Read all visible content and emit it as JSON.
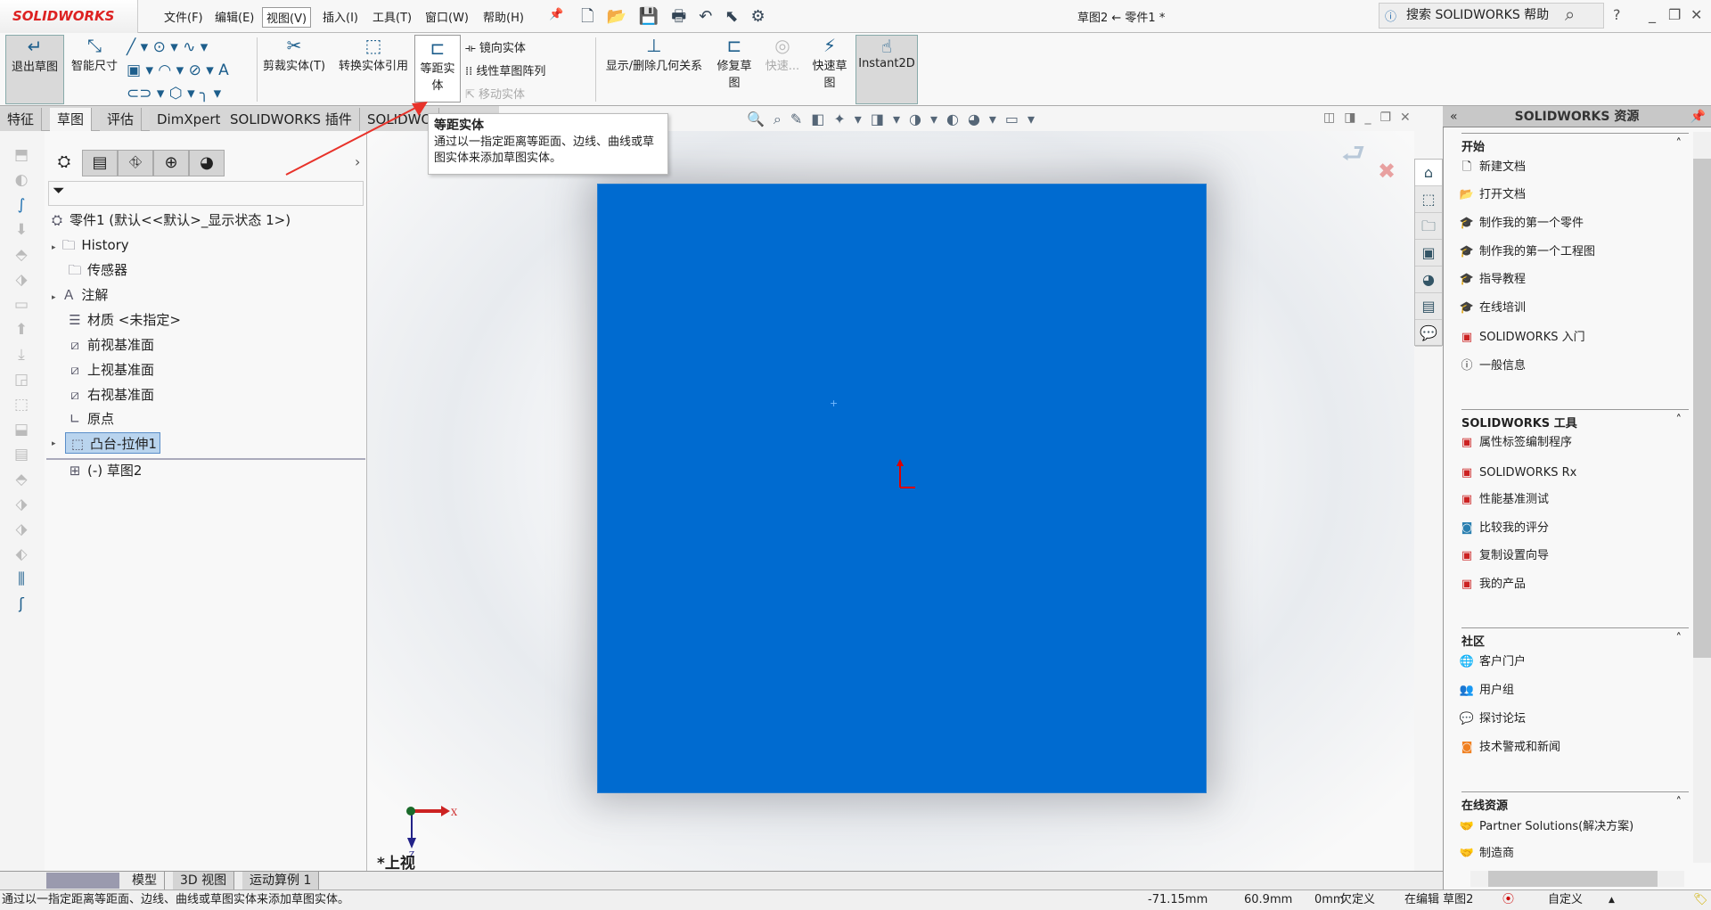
{
  "app": {
    "logo": "SOLIDWORKS",
    "title": "草图2 ← 零件1 *"
  },
  "menu": [
    "文件(F)",
    "编辑(E)",
    "视图(V)",
    "插入(I)",
    "工具(T)",
    "窗口(W)",
    "帮助(H)"
  ],
  "search": {
    "placeholder": "搜索 SOLIDWORKS 帮助"
  },
  "ribbon": {
    "exit_sketch": "退出草图",
    "smart_dim": "智能尺寸",
    "trim": "剪裁实体(T)",
    "convert": "转换实体引用",
    "offset": "等距实体",
    "mirror": "镜向实体",
    "linear_pattern": "线性草图阵列",
    "move": "移动实体",
    "relations": "显示/删除几何关系",
    "repair": "修复草图",
    "quick_snap": "快速...",
    "rapid_sketch": "快速草图",
    "instant2d": "Instant2D"
  },
  "tabs": [
    "特征",
    "草图",
    "评估",
    "DimXpert",
    "SOLIDWORKS 插件",
    "SOLIDWO"
  ],
  "tooltip": {
    "title": "等距实体",
    "body": "通过以一指定距离等距面、边线、曲线或草图实体来添加草图实体。"
  },
  "tree": {
    "root": "零件1  (默认<<默认>_显示状态 1>)",
    "items": [
      "History",
      "传感器",
      "注解",
      "材质 <未指定>",
      "前视基准面",
      "上视基准面",
      "右视基准面",
      "原点",
      "凸台-拉伸1",
      "(-) 草图2"
    ]
  },
  "viewport": {
    "view_label": "*上视",
    "axis_x": "X",
    "axis_z": "Z",
    "sketch_color": "#006bd0"
  },
  "resources": {
    "title": "SOLIDWORKS 资源",
    "sections": [
      {
        "title": "开始",
        "items": [
          "新建文档",
          "打开文档",
          "制作我的第一个零件",
          "制作我的第一个工程图",
          "指导教程",
          "在线培训",
          "SOLIDWORKS 入门",
          "一般信息"
        ]
      },
      {
        "title": "SOLIDWORKS 工具",
        "items": [
          "属性标签编制程序",
          "SOLIDWORKS Rx",
          "性能基准测试",
          "比较我的评分",
          "复制设置向导",
          "我的产品"
        ]
      },
      {
        "title": "社区",
        "items": [
          "客户门户",
          "用户组",
          "探讨论坛",
          "技术警戒和新闻"
        ]
      },
      {
        "title": "在线资源",
        "items": [
          "Partner Solutions(解决方案)",
          "制造商"
        ]
      }
    ]
  },
  "bottom_tabs": [
    "模型",
    "3D 视图",
    "运动算例 1"
  ],
  "status": {
    "message": "通过以一指定距离等距面、边线、曲线或草图实体来添加草图实体。",
    "x": "-71.15mm",
    "y": "60.9mm",
    "z": "0mm",
    "state": "欠定义",
    "editing": "在编辑 草图2",
    "units": "自定义"
  }
}
